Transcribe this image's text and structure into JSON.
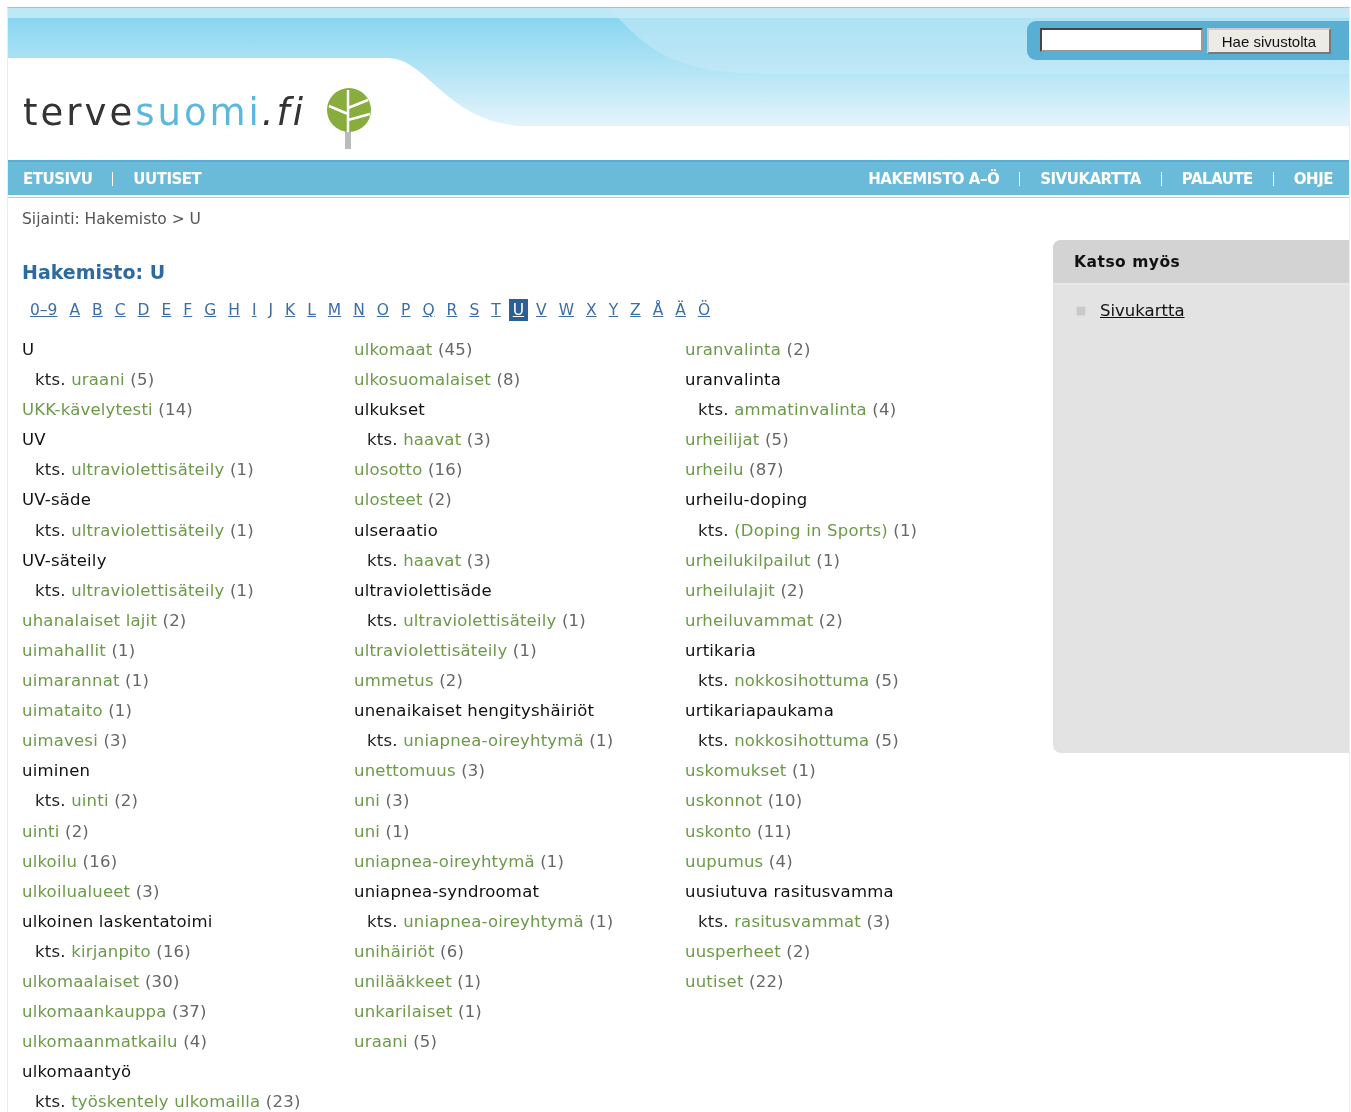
{
  "header": {
    "logo": [
      {
        "kind": "plain",
        "text": "terve"
      },
      {
        "kind": "accent",
        "text": "suomi"
      },
      {
        "kind": "suffix",
        "text": ".fi"
      }
    ],
    "search": {
      "button": "Hae sivustolta"
    }
  },
  "nav": {
    "left": [
      "ETUSIVU",
      "UUTISET"
    ],
    "right": [
      "HAKEMISTO A–Ö",
      "SIVUKARTTA",
      "PALAUTE",
      "OHJE"
    ]
  },
  "breadcrumb": "Sijainti: Hakemisto > U",
  "title": "Hakemisto: U",
  "letters": [
    {
      "label": "0–9",
      "selected": false
    },
    {
      "label": "A",
      "selected": false
    },
    {
      "label": "B",
      "selected": false
    },
    {
      "label": "C",
      "selected": false
    },
    {
      "label": "D",
      "selected": false
    },
    {
      "label": "E",
      "selected": false
    },
    {
      "label": "F",
      "selected": false
    },
    {
      "label": "G",
      "selected": false
    },
    {
      "label": "H",
      "selected": false
    },
    {
      "label": "I",
      "selected": false
    },
    {
      "label": "J",
      "selected": false
    },
    {
      "label": "K",
      "selected": false
    },
    {
      "label": "L",
      "selected": false
    },
    {
      "label": "M",
      "selected": false
    },
    {
      "label": "N",
      "selected": false
    },
    {
      "label": "O",
      "selected": false
    },
    {
      "label": "P",
      "selected": false
    },
    {
      "label": "Q",
      "selected": false
    },
    {
      "label": "R",
      "selected": false
    },
    {
      "label": "S",
      "selected": false
    },
    {
      "label": "T",
      "selected": false
    },
    {
      "label": "U",
      "selected": true
    },
    {
      "label": "V",
      "selected": false
    },
    {
      "label": "W",
      "selected": false
    },
    {
      "label": "X",
      "selected": false
    },
    {
      "label": "Y",
      "selected": false
    },
    {
      "label": "Z",
      "selected": false
    },
    {
      "label": "Å",
      "selected": false
    },
    {
      "label": "Ä",
      "selected": false
    },
    {
      "label": "Ö",
      "selected": false
    }
  ],
  "columns": [
    [
      {
        "kind": "term",
        "text": "U"
      },
      {
        "kind": "see",
        "prefix": "kts.",
        "text": "uraani",
        "count": "(5)"
      },
      {
        "kind": "link",
        "text": "UKK-kävelytesti",
        "count": "(14)"
      },
      {
        "kind": "term",
        "text": "UV"
      },
      {
        "kind": "see",
        "prefix": "kts.",
        "text": "ultraviolettisäteily",
        "count": "(1)"
      },
      {
        "kind": "term",
        "text": "UV-säde"
      },
      {
        "kind": "see",
        "prefix": "kts.",
        "text": "ultraviolettisäteily",
        "count": "(1)"
      },
      {
        "kind": "term",
        "text": "UV-säteily"
      },
      {
        "kind": "see",
        "prefix": "kts.",
        "text": "ultraviolettisäteily",
        "count": "(1)"
      },
      {
        "kind": "link",
        "text": "uhanalaiset lajit",
        "count": "(2)"
      },
      {
        "kind": "link",
        "text": "uimahallit",
        "count": "(1)"
      },
      {
        "kind": "link",
        "text": "uimarannat",
        "count": "(1)"
      },
      {
        "kind": "link",
        "text": "uimataito",
        "count": "(1)"
      },
      {
        "kind": "link",
        "text": "uimavesi",
        "count": "(3)"
      },
      {
        "kind": "term",
        "text": "uiminen"
      },
      {
        "kind": "see",
        "prefix": "kts.",
        "text": "uinti",
        "count": "(2)"
      },
      {
        "kind": "link",
        "text": "uinti",
        "count": "(2)"
      },
      {
        "kind": "link",
        "text": "ulkoilu",
        "count": "(16)"
      },
      {
        "kind": "link",
        "text": "ulkoilualueet",
        "count": "(3)"
      },
      {
        "kind": "term",
        "text": "ulkoinen laskentatoimi"
      },
      {
        "kind": "see",
        "prefix": "kts.",
        "text": "kirjanpito",
        "count": "(16)"
      },
      {
        "kind": "link",
        "text": "ulkomaalaiset",
        "count": "(30)"
      },
      {
        "kind": "link",
        "text": "ulkomaankauppa",
        "count": "(37)"
      },
      {
        "kind": "link",
        "text": "ulkomaanmatkailu",
        "count": "(4)"
      },
      {
        "kind": "term",
        "text": "ulkomaantyö"
      },
      {
        "kind": "see",
        "prefix": "kts.",
        "text": "työskentely ulkomailla",
        "count": "(23)"
      }
    ],
    [
      {
        "kind": "link",
        "text": "ulkomaat",
        "count": "(45)"
      },
      {
        "kind": "link",
        "text": "ulkosuomalaiset",
        "count": "(8)"
      },
      {
        "kind": "term",
        "text": "ulkukset"
      },
      {
        "kind": "see",
        "prefix": "kts.",
        "text": "haavat",
        "count": "(3)"
      },
      {
        "kind": "link",
        "text": "ulosotto",
        "count": "(16)"
      },
      {
        "kind": "link",
        "text": "ulosteet",
        "count": "(2)"
      },
      {
        "kind": "term",
        "text": "ulseraatio"
      },
      {
        "kind": "see",
        "prefix": "kts.",
        "text": "haavat",
        "count": "(3)"
      },
      {
        "kind": "term",
        "text": "ultraviolettisäde"
      },
      {
        "kind": "see",
        "prefix": "kts.",
        "text": "ultraviolettisäteily",
        "count": "(1)"
      },
      {
        "kind": "link",
        "text": "ultraviolettisäteily",
        "count": "(1)"
      },
      {
        "kind": "link",
        "text": "ummetus",
        "count": "(2)"
      },
      {
        "kind": "term",
        "text": "unenaikaiset hengityshäiriöt"
      },
      {
        "kind": "see",
        "prefix": "kts.",
        "text": "uniapnea-oireyhtymä",
        "count": "(1)"
      },
      {
        "kind": "link",
        "text": "unettomuus",
        "count": "(3)"
      },
      {
        "kind": "link",
        "text": "uni",
        "count": "(3)"
      },
      {
        "kind": "link",
        "text": "uni",
        "count": "(1)"
      },
      {
        "kind": "link",
        "text": "uniapnea-oireyhtymä",
        "count": "(1)"
      },
      {
        "kind": "term",
        "text": "uniapnea-syndroomat"
      },
      {
        "kind": "see",
        "prefix": "kts.",
        "text": "uniapnea-oireyhtymä",
        "count": "(1)"
      },
      {
        "kind": "link",
        "text": "unihäiriöt",
        "count": "(6)"
      },
      {
        "kind": "link",
        "text": "unilääkkeet",
        "count": "(1)"
      },
      {
        "kind": "link",
        "text": "unkarilaiset",
        "count": "(1)"
      },
      {
        "kind": "link",
        "text": "uraani",
        "count": "(5)"
      }
    ],
    [
      {
        "kind": "link",
        "text": "uranvalinta",
        "count": "(2)"
      },
      {
        "kind": "term",
        "text": "uranvalinta"
      },
      {
        "kind": "see",
        "prefix": "kts.",
        "text": "ammatinvalinta",
        "count": "(4)"
      },
      {
        "kind": "link",
        "text": "urheilijat",
        "count": "(5)"
      },
      {
        "kind": "link",
        "text": "urheilu",
        "count": "(87)"
      },
      {
        "kind": "term",
        "text": "urheilu-doping"
      },
      {
        "kind": "see",
        "prefix": "kts.",
        "text": "(Doping in Sports)",
        "count": "(1)"
      },
      {
        "kind": "link",
        "text": "urheilukilpailut",
        "count": "(1)"
      },
      {
        "kind": "link",
        "text": "urheilulajit",
        "count": "(2)"
      },
      {
        "kind": "link",
        "text": "urheiluvammat",
        "count": "(2)"
      },
      {
        "kind": "term",
        "text": "urtikaria"
      },
      {
        "kind": "see",
        "prefix": "kts.",
        "text": "nokkosihottuma",
        "count": "(5)"
      },
      {
        "kind": "term",
        "text": "urtikariapaukama"
      },
      {
        "kind": "see",
        "prefix": "kts.",
        "text": "nokkosihottuma",
        "count": "(5)"
      },
      {
        "kind": "link",
        "text": "uskomukset",
        "count": "(1)"
      },
      {
        "kind": "link",
        "text": "uskonnot",
        "count": "(10)"
      },
      {
        "kind": "link",
        "text": "uskonto",
        "count": "(11)"
      },
      {
        "kind": "link",
        "text": "uupumus",
        "count": "(4)"
      },
      {
        "kind": "term",
        "text": "uusiutuva rasitusvamma"
      },
      {
        "kind": "see",
        "prefix": "kts.",
        "text": "rasitusvammat",
        "count": "(3)"
      },
      {
        "kind": "link",
        "text": "uusperheet",
        "count": "(2)"
      },
      {
        "kind": "link",
        "text": "uutiset",
        "count": "(22)"
      }
    ]
  ],
  "sidebar": {
    "title": "Katso myös",
    "links": [
      "Sivukartta"
    ]
  }
}
